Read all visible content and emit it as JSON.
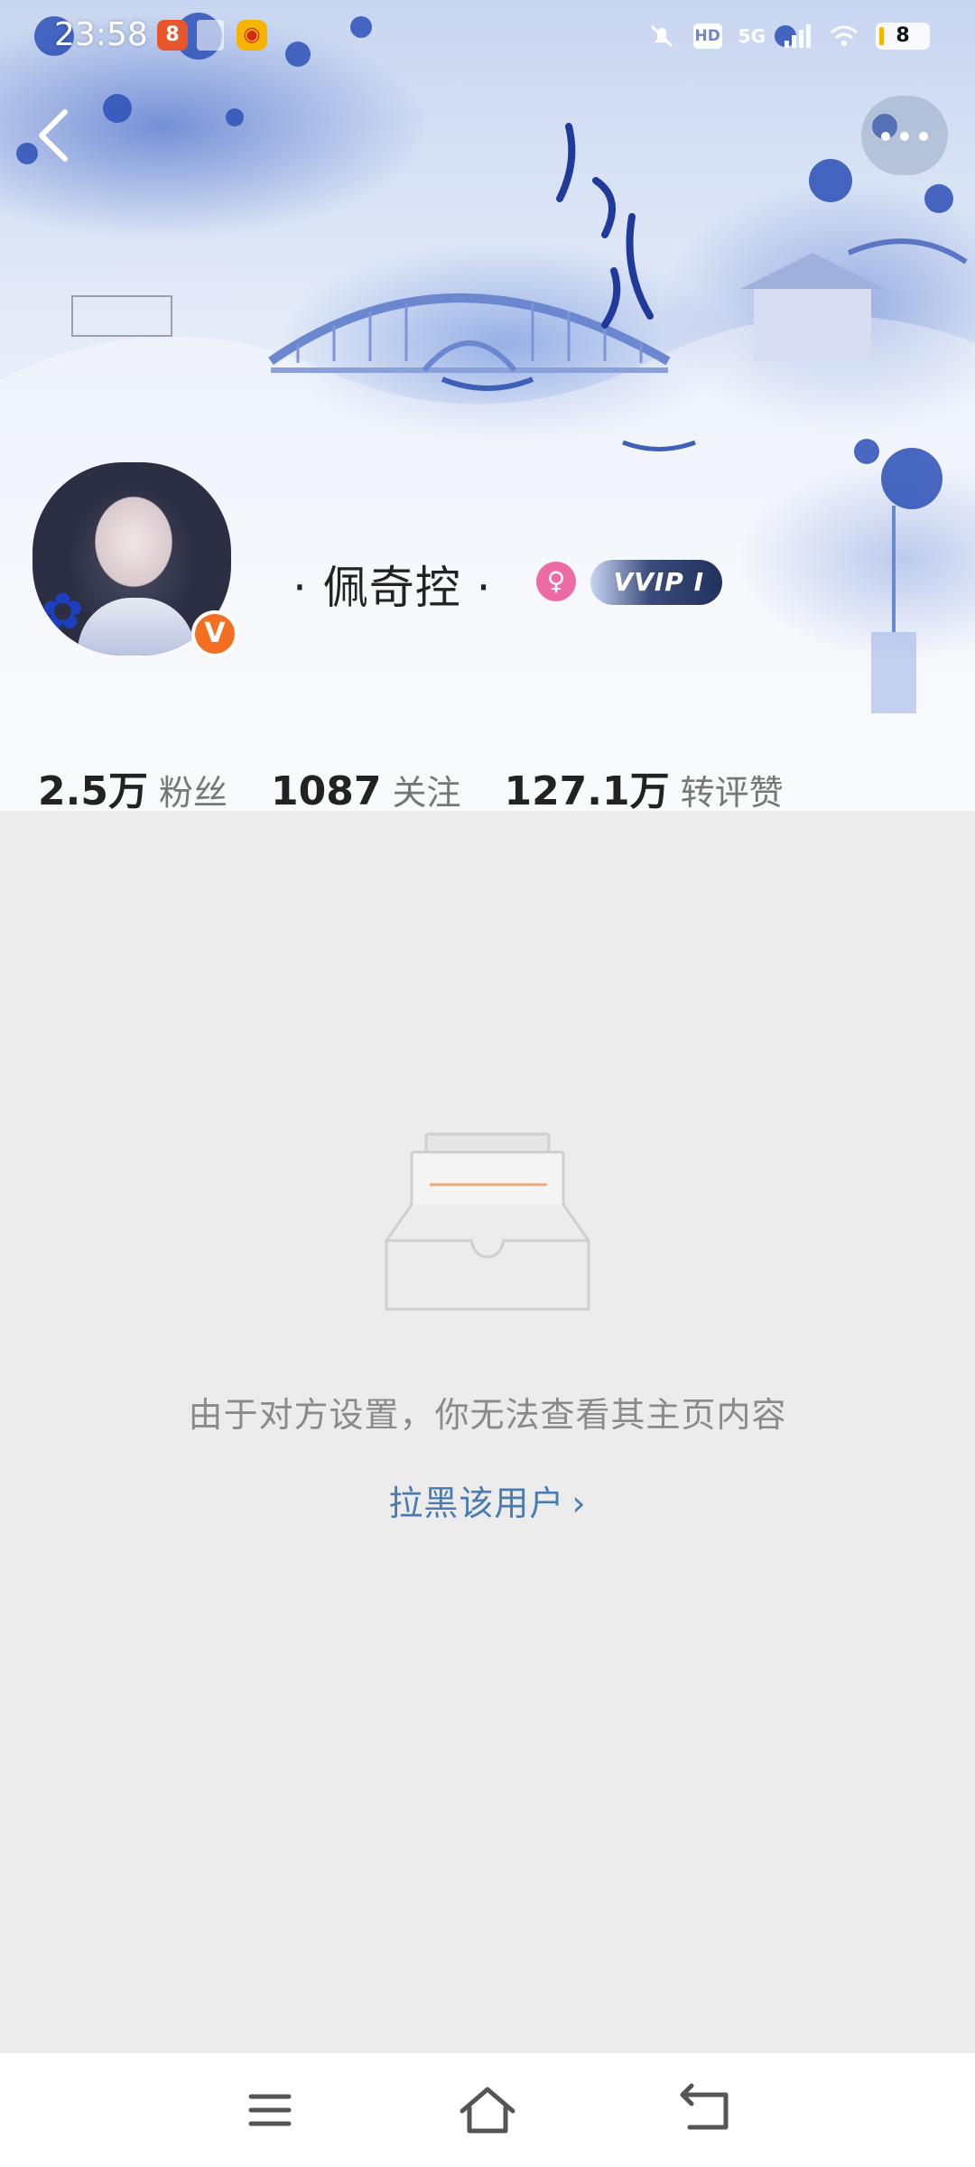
{
  "status_bar": {
    "time": "23:58",
    "battery": "8",
    "network": "5G",
    "hd_badge": "HD",
    "icons": [
      "notification-app-icon",
      "video-icon",
      "weibo-icon",
      "mute-bell-icon",
      "hd-icon",
      "signal-icon",
      "wifi-icon",
      "battery-icon"
    ]
  },
  "nav": {
    "back_icon": "chevron-left-icon",
    "more_icon": "more-dots-icon"
  },
  "profile": {
    "name": "· 佩奇控 ·",
    "verified_badge": "V",
    "gender_icon": "female-icon",
    "vip_badge": "VVIP I",
    "stats": [
      {
        "value": "2.5万",
        "label": "粉丝"
      },
      {
        "value": "1087",
        "label": "关注"
      },
      {
        "value": "127.1万",
        "label": "转评赞"
      }
    ]
  },
  "empty_state": {
    "message": "由于对方设置，你无法查看其主页内容",
    "action": "拉黑该用户",
    "action_chevron": "›"
  },
  "system_nav": {
    "buttons": [
      "menu-icon",
      "home-icon",
      "back-icon"
    ]
  },
  "colors": {
    "verified": "#f36f21",
    "female": "#ec6aa5",
    "link": "#4a7cb0",
    "empty_bg": "#ececec"
  }
}
